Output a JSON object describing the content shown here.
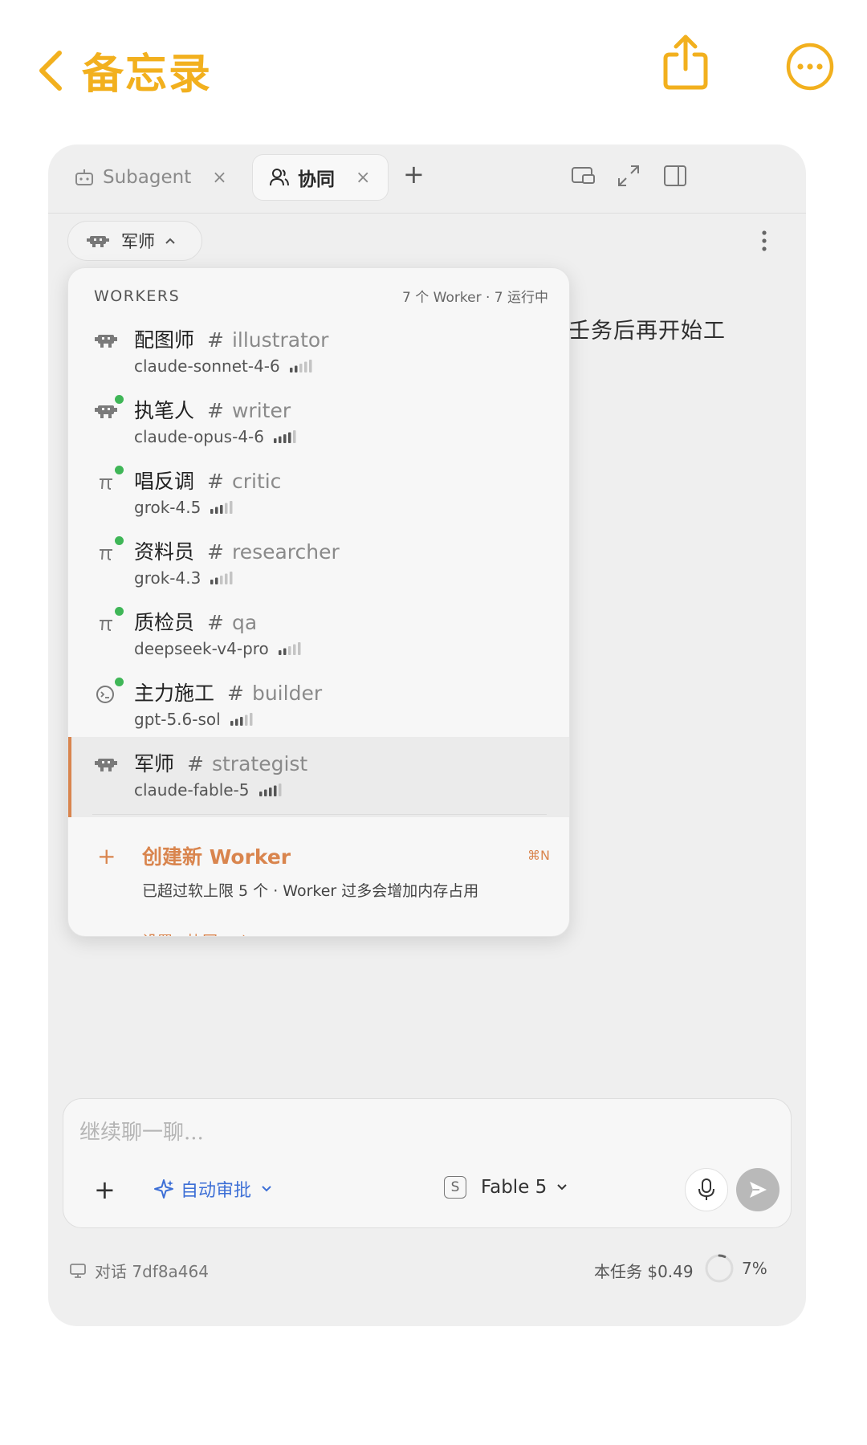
{
  "nav": {
    "back_label": "备忘录",
    "share_icon": "share-icon",
    "more_icon": "ellipsis-circle-icon",
    "accent_color": "#f2b01e"
  },
  "tabs": [
    {
      "label": "Subagent",
      "icon": "robot-icon",
      "active": false
    },
    {
      "label": "协同",
      "icon": "people-icon",
      "active": true
    }
  ],
  "tab_close_glyph": "×",
  "tab_add_glyph": "+",
  "agent_pill": {
    "label": "军师",
    "icon": "robot-icon"
  },
  "behind_text": "壬务后再开始工",
  "workers_panel": {
    "title": "WORKERS",
    "count": "7 个 Worker · 7 运行中",
    "items": [
      {
        "name": "配图师",
        "role": "illustrator",
        "model": "claude-sonnet-4-6",
        "icon": "robot-icon",
        "online": false,
        "signal": 2
      },
      {
        "name": "执笔人",
        "role": "writer",
        "model": "claude-opus-4-6",
        "icon": "robot-icon",
        "online": true,
        "signal": 4
      },
      {
        "name": "唱反调",
        "role": "critic",
        "model": "grok-4.5",
        "icon": "pi-icon",
        "online": true,
        "signal": 3
      },
      {
        "name": "资料员",
        "role": "researcher",
        "model": "grok-4.3",
        "icon": "pi-icon",
        "online": true,
        "signal": 2
      },
      {
        "name": "质检员",
        "role": "qa",
        "model": "deepseek-v4-pro",
        "icon": "pi-icon",
        "online": true,
        "signal": 2
      },
      {
        "name": "主力施工",
        "role": "builder",
        "model": "gpt-5.6-sol",
        "icon": "terminal-face-icon",
        "online": true,
        "signal": 3
      },
      {
        "name": "军师",
        "role": "strategist",
        "model": "claude-fable-5",
        "icon": "robot-icon",
        "online": false,
        "signal": 4,
        "active": true
      }
    ],
    "hash": "#",
    "create": {
      "plus": "+",
      "label": "创建新 Worker",
      "shortcut": "⌘N",
      "warning": "已超过软上限 5 个 · Worker 过多会增加内存占用",
      "link": "设置 · 协同",
      "link_arrow": "›"
    },
    "accent_color": "#d9854e",
    "online_color": "#3fb657"
  },
  "composer": {
    "placeholder": "继续聊一聊...",
    "value": "",
    "plus": "+",
    "approval_label": "自动审批",
    "model_badge": "S",
    "model_label": "Fable 5",
    "mic_icon": "microphone-icon",
    "send_icon": "send-icon"
  },
  "footer": {
    "conversation": "对话 7df8a464",
    "cost": "本任务 $0.49",
    "context_percent": "7%",
    "context_fraction": 0.07
  }
}
